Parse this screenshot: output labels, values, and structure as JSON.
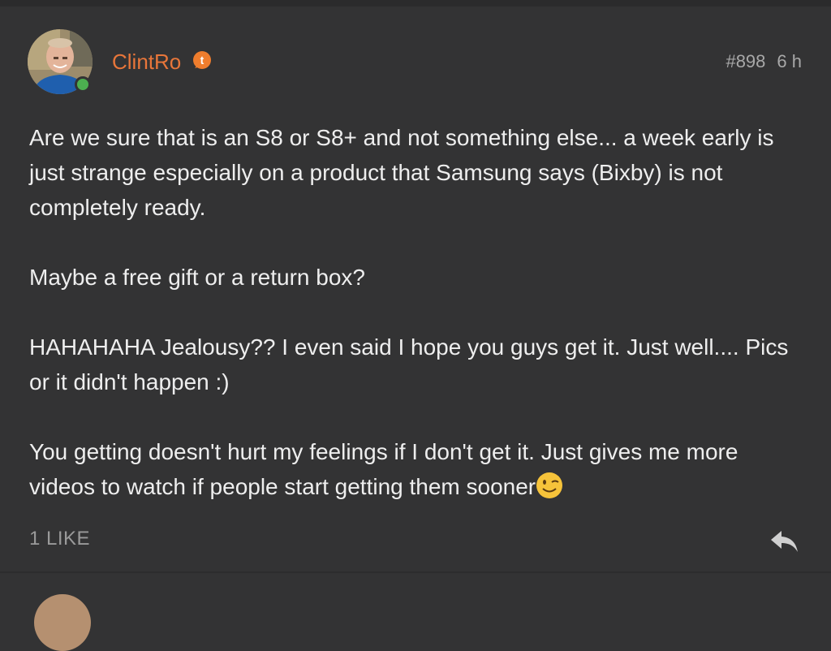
{
  "post": {
    "author": "ClintRo",
    "author_badge_icon": "tapatalk-badge-icon",
    "post_number": "#898",
    "time_ago": "6 h",
    "paragraphs": [
      "Are we sure that is an S8 or S8+ and not something else... a week early is just strange especially on a product that Samsung says (Bixby) is not completely ready.",
      "Maybe a free gift or a return box?",
      "HAHAHAHA Jealousy?? I even said I hope you guys get it. Just well.... Pics or it didn't happen :)",
      "You getting doesn't hurt my feelings if I don't get it. Just gives me more videos to watch if people start getting them sooner"
    ],
    "trailing_emoji": "wink-emoji",
    "likes": "1 LIKE",
    "reply_icon": "reply-icon"
  },
  "colors": {
    "background": "#333334",
    "username": "#e8763a",
    "online": "#4caf50",
    "text": "#eeeeee",
    "muted": "#a8a8a8"
  }
}
